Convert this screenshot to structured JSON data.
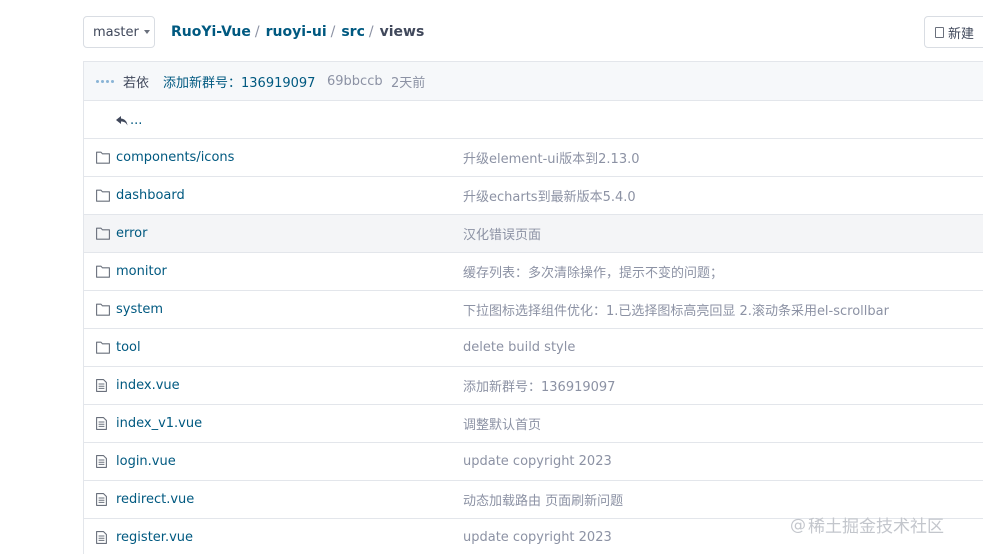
{
  "toolbar": {
    "branch": "master",
    "breadcrumb": [
      "RuoYi-Vue",
      "ruoyi-ui",
      "src",
      "views"
    ],
    "new_file_label": "新建"
  },
  "commit": {
    "author": "若依",
    "message": "添加新群号：136919097",
    "sha": "69bbccb",
    "time": "2天前"
  },
  "parent_link": "...",
  "files": [
    {
      "type": "folder",
      "name": "components/icons",
      "message": "升级element-ui版本到2.13.0",
      "highlight": false
    },
    {
      "type": "folder",
      "name": "dashboard",
      "message": "升级echarts到最新版本5.4.0",
      "highlight": false
    },
    {
      "type": "folder",
      "name": "error",
      "message": "汉化错误页面",
      "highlight": true
    },
    {
      "type": "folder",
      "name": "monitor",
      "message": "缓存列表：多次清除操作，提示不变的问题；",
      "highlight": false
    },
    {
      "type": "folder",
      "name": "system",
      "message": "下拉图标选择组件优化：1.已选择图标高亮回显 2.滚动条采用el-scrollbar",
      "highlight": false
    },
    {
      "type": "folder",
      "name": "tool",
      "message": "delete build style",
      "highlight": false
    },
    {
      "type": "file",
      "name": "index.vue",
      "message": "添加新群号：136919097",
      "highlight": false
    },
    {
      "type": "file",
      "name": "index_v1.vue",
      "message": "调整默认首页",
      "highlight": false
    },
    {
      "type": "file",
      "name": "login.vue",
      "message": "update copyright 2023",
      "highlight": false
    },
    {
      "type": "file",
      "name": "redirect.vue",
      "message": "动态加载路由 页面刷新问题",
      "highlight": false
    },
    {
      "type": "file",
      "name": "register.vue",
      "message": "update copyright 2023",
      "highlight": false
    }
  ],
  "watermark": {
    "at": "@",
    "text": "稀土掘金技术社区"
  },
  "colors": {
    "link": "#005980",
    "muted": "#8c92a4",
    "border": "#e3e6eb",
    "highlight_row": "#f4f5f7"
  }
}
